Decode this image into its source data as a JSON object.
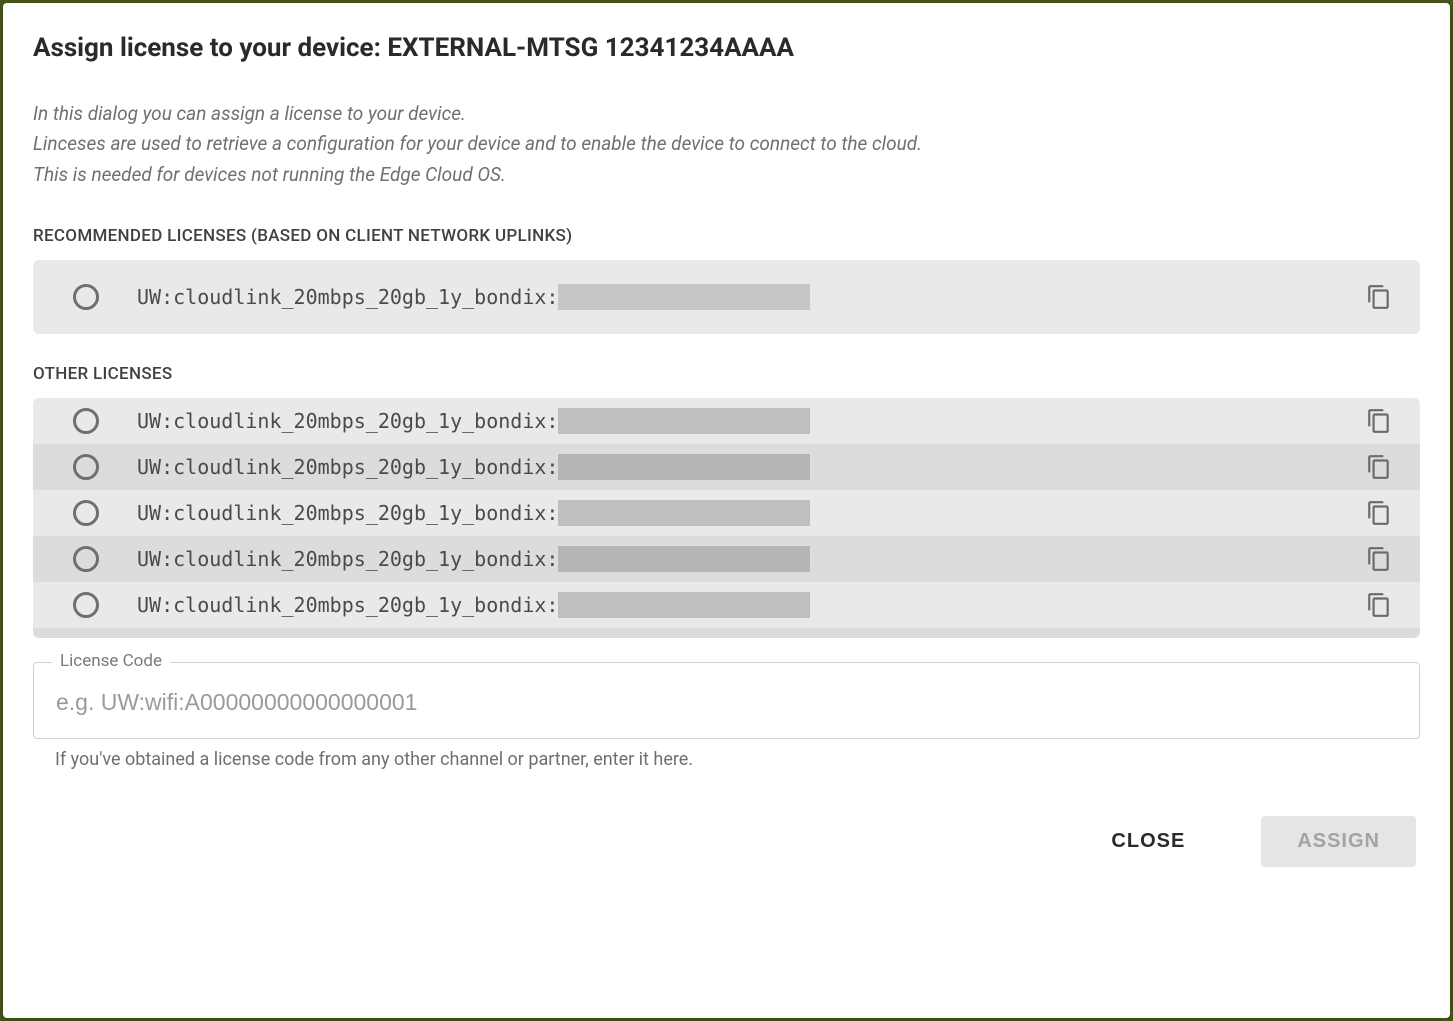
{
  "dialog": {
    "title": "Assign license to your device: EXTERNAL-MTSG 12341234AAAA",
    "description": "In this dialog you can assign a license to your device.\nLinceses are used to retrieve a configuration for your device and to enable the device to connect to the cloud.\nThis is needed for devices not running the Edge Cloud OS."
  },
  "sections": {
    "recommended": {
      "header": "RECOMMENDED LICENSES (BASED ON CLIENT NETWORK UPLINKS)",
      "items": [
        {
          "label": "UW:cloudlink_20mbps_20gb_1y_bondix:"
        }
      ]
    },
    "other": {
      "header": "OTHER LICENSES",
      "items": [
        {
          "label": "UW:cloudlink_20mbps_20gb_1y_bondix:"
        },
        {
          "label": "UW:cloudlink_20mbps_20gb_1y_bondix:"
        },
        {
          "label": "UW:cloudlink_20mbps_20gb_1y_bondix:"
        },
        {
          "label": "UW:cloudlink_20mbps_20gb_1y_bondix:"
        },
        {
          "label": "UW:cloudlink_20mbps_20gb_1y_bondix:"
        }
      ]
    }
  },
  "license_code": {
    "label": "License Code",
    "placeholder": "e.g. UW:wifi:A00000000000000001",
    "value": "",
    "help": "If you've obtained a license code from any other channel or partner, enter it here."
  },
  "actions": {
    "close": "CLOSE",
    "assign": "ASSIGN"
  }
}
